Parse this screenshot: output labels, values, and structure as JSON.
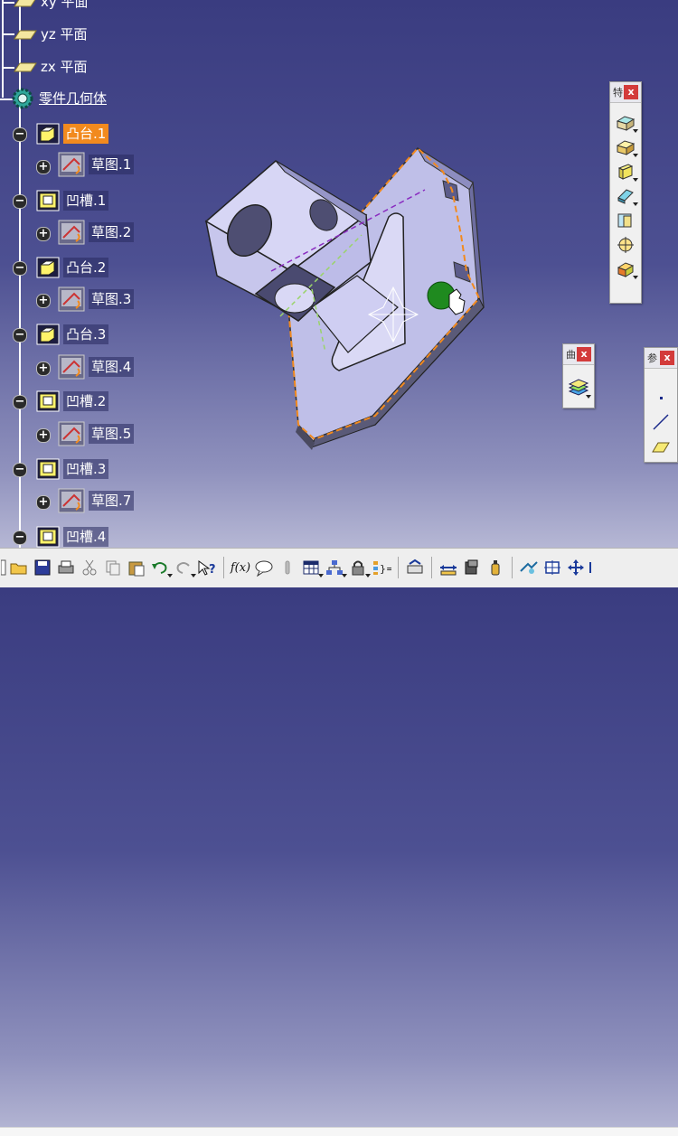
{
  "tree": {
    "planes": [
      {
        "label": "xy 平面"
      },
      {
        "label": "yz 平面"
      },
      {
        "label": "zx 平面"
      }
    ],
    "body": {
      "label": "零件几何体"
    },
    "features": [
      {
        "label": "凸台.1",
        "type": "pad",
        "selected": true,
        "sketch": "草图.1"
      },
      {
        "label": "凹槽.1",
        "type": "pocket",
        "selected": false,
        "sketch": "草图.2"
      },
      {
        "label": "凸台.2",
        "type": "pad",
        "selected": false,
        "sketch": "草图.3"
      },
      {
        "label": "凸台.3",
        "type": "pad",
        "selected": false,
        "sketch": "草图.4"
      },
      {
        "label": "凹槽.2",
        "type": "pocket",
        "selected": false,
        "sketch": "草图.5"
      },
      {
        "label": "凹槽.3",
        "type": "pocket",
        "selected": false,
        "sketch": "草图.7"
      },
      {
        "label": "凹槽.4",
        "type": "pocket",
        "selected": false,
        "sketch": ""
      }
    ],
    "expander_plus": "+",
    "expander_minus": "−"
  },
  "toolbars": {
    "right_tall": {
      "title": "特",
      "close": "x",
      "tools": [
        "pad-tool-icon",
        "pocket-tool-icon",
        "shaft-tool-icon",
        "groove-tool-icon",
        "hole-tool-icon",
        "rib-tool-icon",
        "slot-tool-icon"
      ]
    },
    "small_mid": {
      "title": "曲",
      "close": "x",
      "tools": [
        "surface-stack-icon"
      ]
    },
    "small_right": {
      "title": "参",
      "close": "x",
      "tools": [
        "point-tool-icon",
        "line-tool-icon",
        "plane-tool-icon"
      ]
    }
  },
  "bottom_toolbar": {
    "fx_label": "f(x)"
  },
  "colors": {
    "selection": "#f28a1e",
    "background_top": "#3a3c80",
    "part": "#c9c9f0",
    "compass_green": "#1f8a1f"
  }
}
